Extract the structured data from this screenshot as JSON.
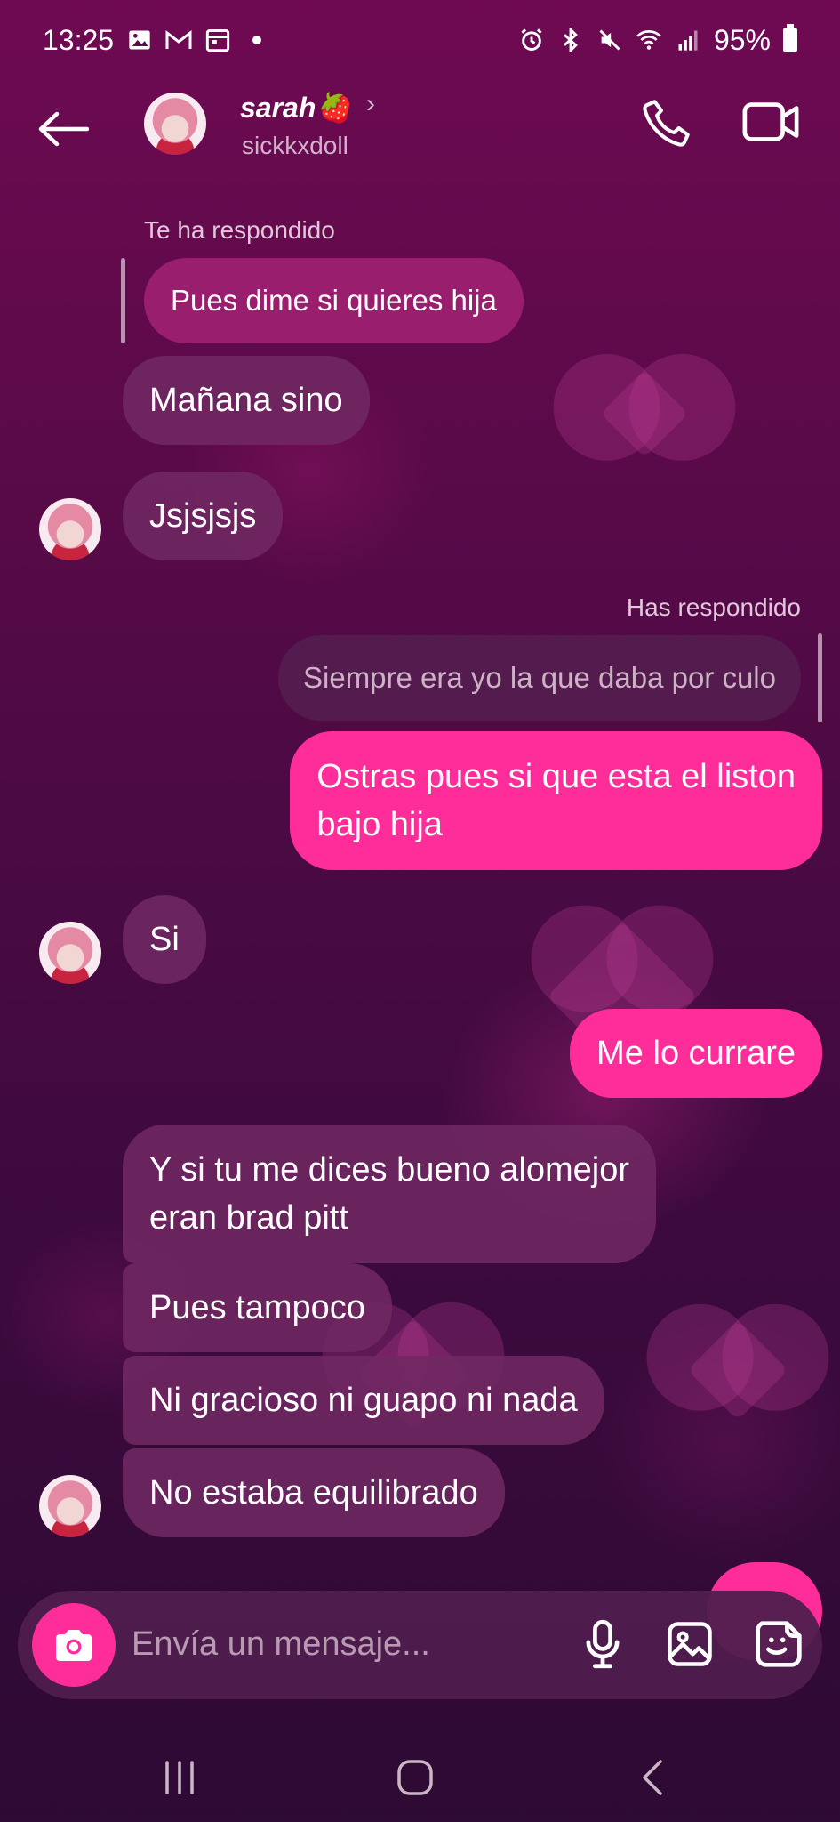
{
  "status_bar": {
    "time": "13:25",
    "battery": "95%"
  },
  "header": {
    "name": "sarah🍓",
    "username": "sickkxdoll"
  },
  "messages": {
    "reply_label_in": "Te ha respondido",
    "quoted_in": "Pues dime si quieres hija",
    "m1": "Mañana sino",
    "m2": "Jsjsjsjs",
    "reply_label_out": "Has respondido",
    "quoted_out": "Siempre era yo la que daba por culo",
    "m3_line1": "Ostras pues si que esta el liston",
    "m3_line2": "bajo hija",
    "m4": "Si",
    "m5": "Me lo currare",
    "m6_line1": "Y si tu me dices bueno alomejor",
    "m6_line2": "eran brad pitt",
    "m7": "Pues tampoco",
    "m8": "Ni gracioso ni guapo ni nada",
    "m9": "No estaba equilibrado"
  },
  "composer": {
    "placeholder": "Envía un mensaje..."
  },
  "colors": {
    "accent": "#ff2d9a",
    "incoming_bubble": "#702862",
    "background_top": "#6f0a52",
    "background_bottom": "#2d0a33"
  },
  "icons": {
    "back": "arrow-left-icon",
    "call": "phone-icon",
    "video": "video-camera-icon",
    "camera": "camera-icon",
    "mic": "microphone-icon",
    "gallery": "image-icon",
    "sticker": "sticker-icon"
  }
}
